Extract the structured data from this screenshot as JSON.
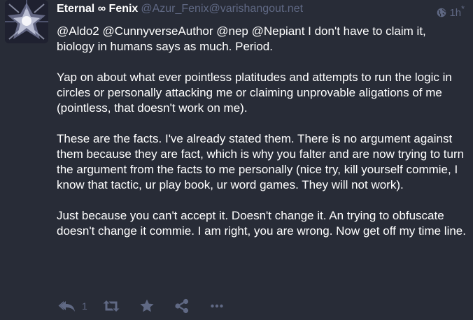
{
  "status": {
    "display_name": "Eternal ∞ Fenix",
    "account": "@Azur_Fenix@varishangout.net",
    "visibility_icon": "globe-icon",
    "timestamp": "1h",
    "timestamp_marker": "*",
    "paragraphs": [
      "@Aldo2 @CunnyverseAuthor @nep @Nepiant I don't have to claim it, biology in humans says as much. Period.",
      "Yap on about what ever pointless platitudes and attempts to run the logic in circles or personally attacking me or claiming unprovable aligations of me (pointless, that doesn't work on me).",
      "These are the facts. I've already stated them. There is no argument against them because they are fact, which is why you falter and are now trying to turn the argument from the facts to me personally (nice try, kill yourself commie, I know that tactic, ur play book, ur word games. They will not work).",
      "Just because you can't accept it. Doesn't change it. An trying to obfuscate doesn't change it commie. I am right, you are wrong. Now get off my time line."
    ]
  },
  "actions": {
    "reply_icon": "reply-all-icon",
    "reply_count": "1",
    "boost_icon": "retweet-icon",
    "favourite_icon": "star-icon",
    "share_icon": "share-icon",
    "more_icon": "ellipsis-icon"
  },
  "colors": {
    "background": "#282c37",
    "text": "#ffffff",
    "muted": "#606984"
  }
}
